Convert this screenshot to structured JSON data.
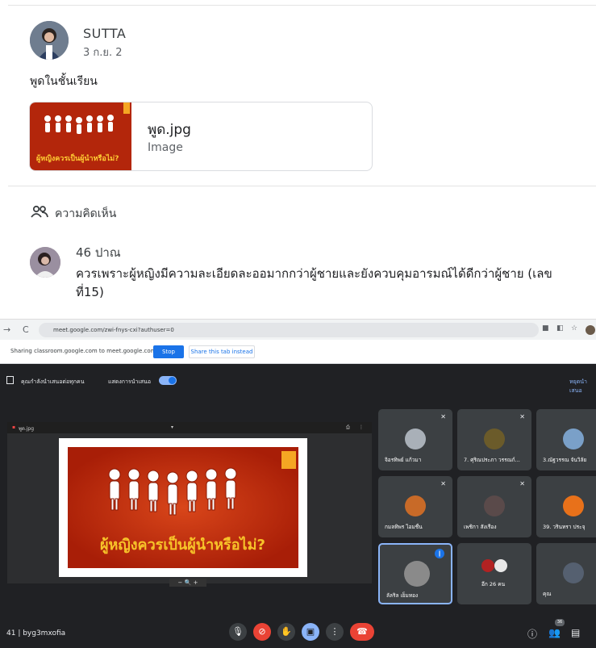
{
  "post": {
    "author": "SUTTA",
    "date": "3 ก.ย. 2",
    "text": "พูดในชั้นเรียน",
    "attachment": {
      "name": "พูด.jpg",
      "type": "Image",
      "thumb_caption": "ผู้หญิงควรเป็นผู้นำหรือไม่?"
    }
  },
  "comments": {
    "header": "ความคิดเห็น",
    "items": [
      {
        "author": "46 ปาณ",
        "text": "ควรเพราะผู้หญิงมีความละเอียดละออมากกว่าผู้ชายและยังควบคุมอารมณ์ได้ดีกว่าผู้ชาย (เลขที่15)"
      }
    ]
  },
  "screenshot": {
    "browser": {
      "url": "meet.google.com/zwi-fnys-cxi?authuser=0",
      "back": "←",
      "forward": "→",
      "reload": "C"
    },
    "share_bar": {
      "message": "Sharing classroom.google.com to meet.google.com",
      "stop_label": "Stop",
      "share_instead_label": "Share this tab instead"
    },
    "meet_bar": {
      "presenting_text": "คุณกำลังนำเสนอต่อทุกคน",
      "show_presentation_label": "แสดงการนำเสนอ",
      "stop_presenting_label": "หยุดนำเสนอ"
    },
    "presentation": {
      "file_label": "พูด.jpg",
      "slide_caption": "ผู้หญิงควรเป็นผู้นำหรือไม่?",
      "zoom_controls": "− 🔍 +"
    },
    "participants": [
      {
        "name": "จิอรทิพย์ แก้วมา",
        "face_color": "#a9b0b8"
      },
      {
        "name": "7. ศุริณประภา วรรณก์...",
        "face_color": "#6b5b2a"
      },
      {
        "name": "3.ณัฐวรรณ จันวิลัย",
        "face_color": "#7aa0c8"
      },
      {
        "name": "กมลทิพร ไอมชื่น",
        "face_color": "#c86a28"
      },
      {
        "name": "เพชิกา สังเรือง",
        "face_color": "#5a4a4a"
      },
      {
        "name": "39. วรินทรา ประจุ",
        "face_color": "#e8711a"
      },
      {
        "name": "ลัลริล เย็มทอง",
        "face_color": "#8a8a8a"
      },
      {
        "name": "อีก 26 คน",
        "face_color": "#b22222"
      },
      {
        "name": "คุณ",
        "face_color": "#556070"
      }
    ],
    "controls": {
      "meeting_code": "41 | byg3mxofia",
      "people_count": "36"
    }
  }
}
